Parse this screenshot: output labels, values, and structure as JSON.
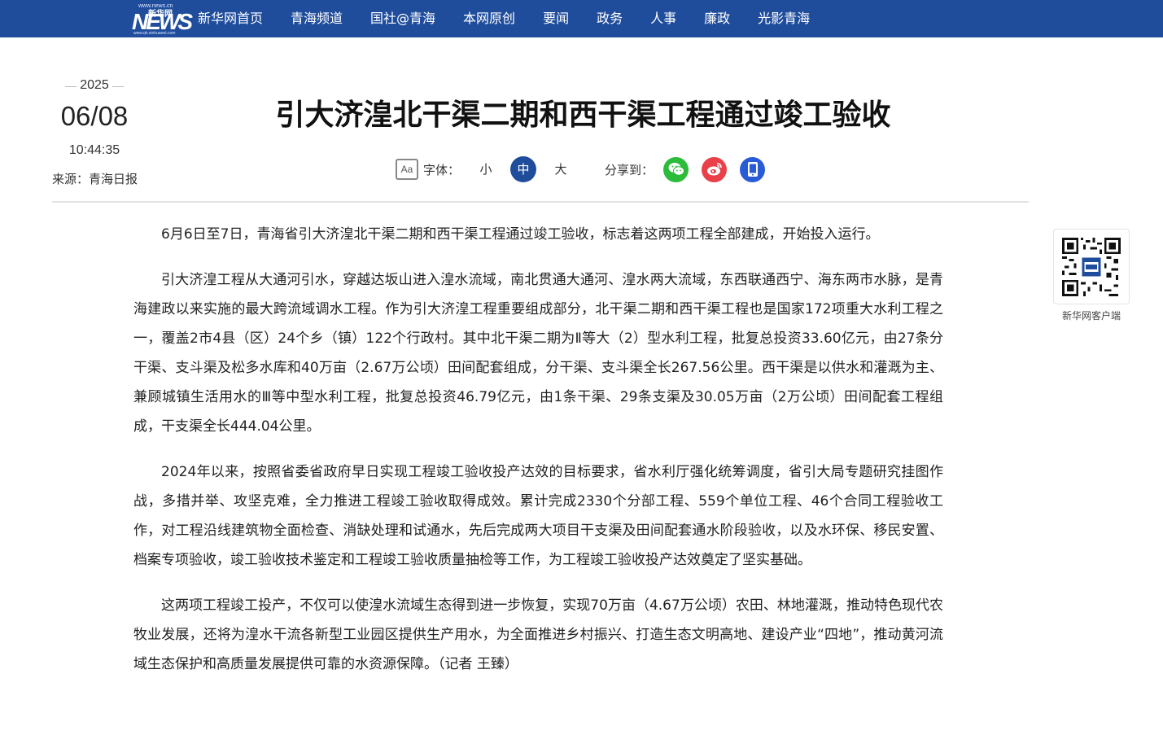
{
  "nav": {
    "logo_top": "www.news.cn",
    "logo_cn": "新华网",
    "logo_mark": "NEWS",
    "logo_bottom": "www.qh.xinhuanet.com",
    "items": [
      "新华网首页",
      "青海频道",
      "国社@青海",
      "本网原创",
      "要闻",
      "政务",
      "人事",
      "廉政",
      "光影青海"
    ]
  },
  "date": {
    "year": "2025",
    "month_day": "06/08",
    "time": "10:44:35"
  },
  "source": "来源：青海日报",
  "title": "引大济湟北干渠二期和西干渠工程通过竣工验收",
  "font_tools": {
    "icon": "Aa",
    "label": "字体：",
    "small": "小",
    "medium": "中",
    "large": "大",
    "selected": "中"
  },
  "share": {
    "label": "分享到：",
    "icons": [
      "wechat-icon",
      "weibo-icon",
      "mobile-icon"
    ]
  },
  "article": {
    "paragraphs": [
      "6月6日至7日，青海省引大济湟北干渠二期和西干渠工程通过竣工验收，标志着这两项工程全部建成，开始投入运行。",
      "引大济湟工程从大通河引水，穿越达坂山进入湟水流域，南北贯通大通河、湟水两大流域，东西联通西宁、海东两市水脉，是青海建政以来实施的最大跨流域调水工程。作为引大济湟工程重要组成部分，北干渠二期和西干渠工程也是国家172项重大水利工程之一，覆盖2市4县（区）24个乡（镇）122个行政村。其中北干渠二期为Ⅱ等大（2）型水利工程，批复总投资33.60亿元，由27条分干渠、支斗渠及松多水库和40万亩（2.67万公顷）田间配套组成，分干渠、支斗渠全长267.56公里。西干渠是以供水和灌溉为主、兼顾城镇生活用水的Ⅲ等中型水利工程，批复总投资46.79亿元，由1条干渠、29条支渠及30.05万亩（2万公顷）田间配套工程组成，干支渠全长444.04公里。",
      "2024年以来，按照省委省政府早日实现工程竣工验收投产达效的目标要求，省水利厅强化统筹调度，省引大局专题研究挂图作战，多措并举、攻坚克难，全力推进工程竣工验收取得成效。累计完成2330个分部工程、559个单位工程、46个合同工程验收工作，对工程沿线建筑物全面检查、消缺处理和试通水，先后完成两大项目干支渠及田间配套通水阶段验收，以及水环保、移民安置、档案专项验收，竣工验收技术鉴定和工程竣工验收质量抽检等工作，为工程竣工验收投产达效奠定了坚实基础。",
      "这两项工程竣工投产，不仅可以使湟水流域生态得到进一步恢复，实现70万亩（4.67万公顷）农田、林地灌溉，推动特色现代农牧业发展，还将为湟水干流各新型工业园区提供生产用水，为全面推进乡村振兴、打造生态文明高地、建设产业“四地”，推动黄河流域生态保护和高质量发展提供可靠的水资源保障。（记者 王臻）"
    ]
  },
  "qr": {
    "caption": "新华网客户端",
    "icon": "qr-code-icon"
  },
  "colors": {
    "nav_bg": "#1f4d9c",
    "active_size": "#1f4d9c",
    "wechat": "#2dbb3b",
    "weibo": "#e9404a",
    "app": "#2a5bd7"
  }
}
